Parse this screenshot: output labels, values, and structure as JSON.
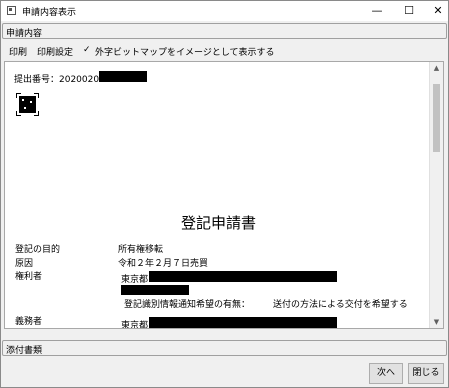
{
  "window": {
    "title": "申請内容表示",
    "min_icon": "minimize-icon",
    "max_icon": "maximize-icon",
    "close_icon": "close-icon"
  },
  "sections": {
    "content_header": "申請内容",
    "attachments_header": "添付書類"
  },
  "toolbar": {
    "print": "印刷",
    "print_settings": "印刷設定",
    "check_mark": "✓",
    "external_chars": "外字ビットマップをイメージとして表示する"
  },
  "document": {
    "submission_number": "提出番号：20200205",
    "heading": "登記申請書",
    "rows": {
      "purpose_label": "登記の目的",
      "purpose_value": "所有権移転",
      "cause_label": "原因",
      "cause_value": "令和２年２月７日売買",
      "holder_label": "権利者",
      "holder_address": "東京都",
      "notify_label": "登記識別情報通知希望の有無：",
      "notify_value": "送付の方法による交付を希望する",
      "obligor_label": "義務者",
      "obligor_address": "東京都"
    }
  },
  "buttons": {
    "next": "次へ",
    "close": "閉じる"
  }
}
